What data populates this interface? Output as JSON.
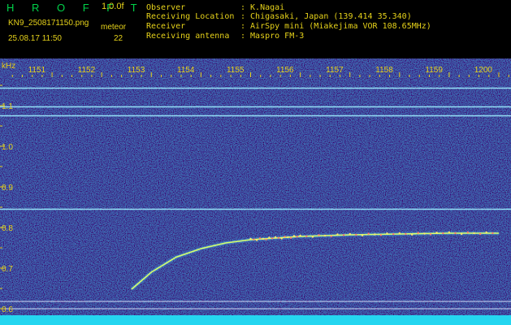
{
  "header": {
    "app_name": "H R O F F T",
    "version": "1.0.0f",
    "filename": "KN9_2508171150.png",
    "timestamp": "25.08.17 11:50",
    "meteor_label": "meteor",
    "meteor_count": "22",
    "info": [
      {
        "label": "Observer",
        "value": ": K.Nagai"
      },
      {
        "label": "Receiving Location",
        "value": ": Chigasaki, Japan (139.414 35.340)"
      },
      {
        "label": "Receiver",
        "value": ": AirSpy mini (Miakejima VOR 108.65MHz)"
      },
      {
        "label": "Receiving antenna",
        "value": ": Maspro FM-3"
      }
    ],
    "accent_color": "#e6d21a",
    "brand_color": "#00d24a"
  },
  "chart_data": {
    "type": "heatmap",
    "y_unit": "kHz",
    "x_ticks": [
      "1151",
      "1152",
      "1153",
      "1154",
      "1155",
      "1156",
      "1157",
      "1158",
      "1159",
      "1200"
    ],
    "y_ticks": [
      "1.1",
      "1.0",
      "0.9",
      "0.8",
      "0.7",
      "0.6"
    ],
    "x_range": [
      "1150",
      "1200"
    ],
    "y_range": [
      0.58,
      1.16
    ],
    "horizontal_lines_khz": [
      1.143,
      1.097,
      1.075,
      0.845,
      0.618,
      0.6
    ],
    "meteor_trace": [
      {
        "t": "1152.60",
        "f": 0.648
      },
      {
        "t": "1153.00",
        "f": 0.69
      },
      {
        "t": "1153.50",
        "f": 0.727
      },
      {
        "t": "1154.00",
        "f": 0.748
      },
      {
        "t": "1154.50",
        "f": 0.762
      },
      {
        "t": "1155.00",
        "f": 0.77
      },
      {
        "t": "1155.50",
        "f": 0.774
      },
      {
        "t": "1156.00",
        "f": 0.778
      },
      {
        "t": "1157.00",
        "f": 0.782
      },
      {
        "t": "1158.00",
        "f": 0.784
      },
      {
        "t": "1159.00",
        "f": 0.786
      },
      {
        "t": "1200.00",
        "f": 0.786
      }
    ],
    "background_color": "#06107a",
    "grid": false
  }
}
